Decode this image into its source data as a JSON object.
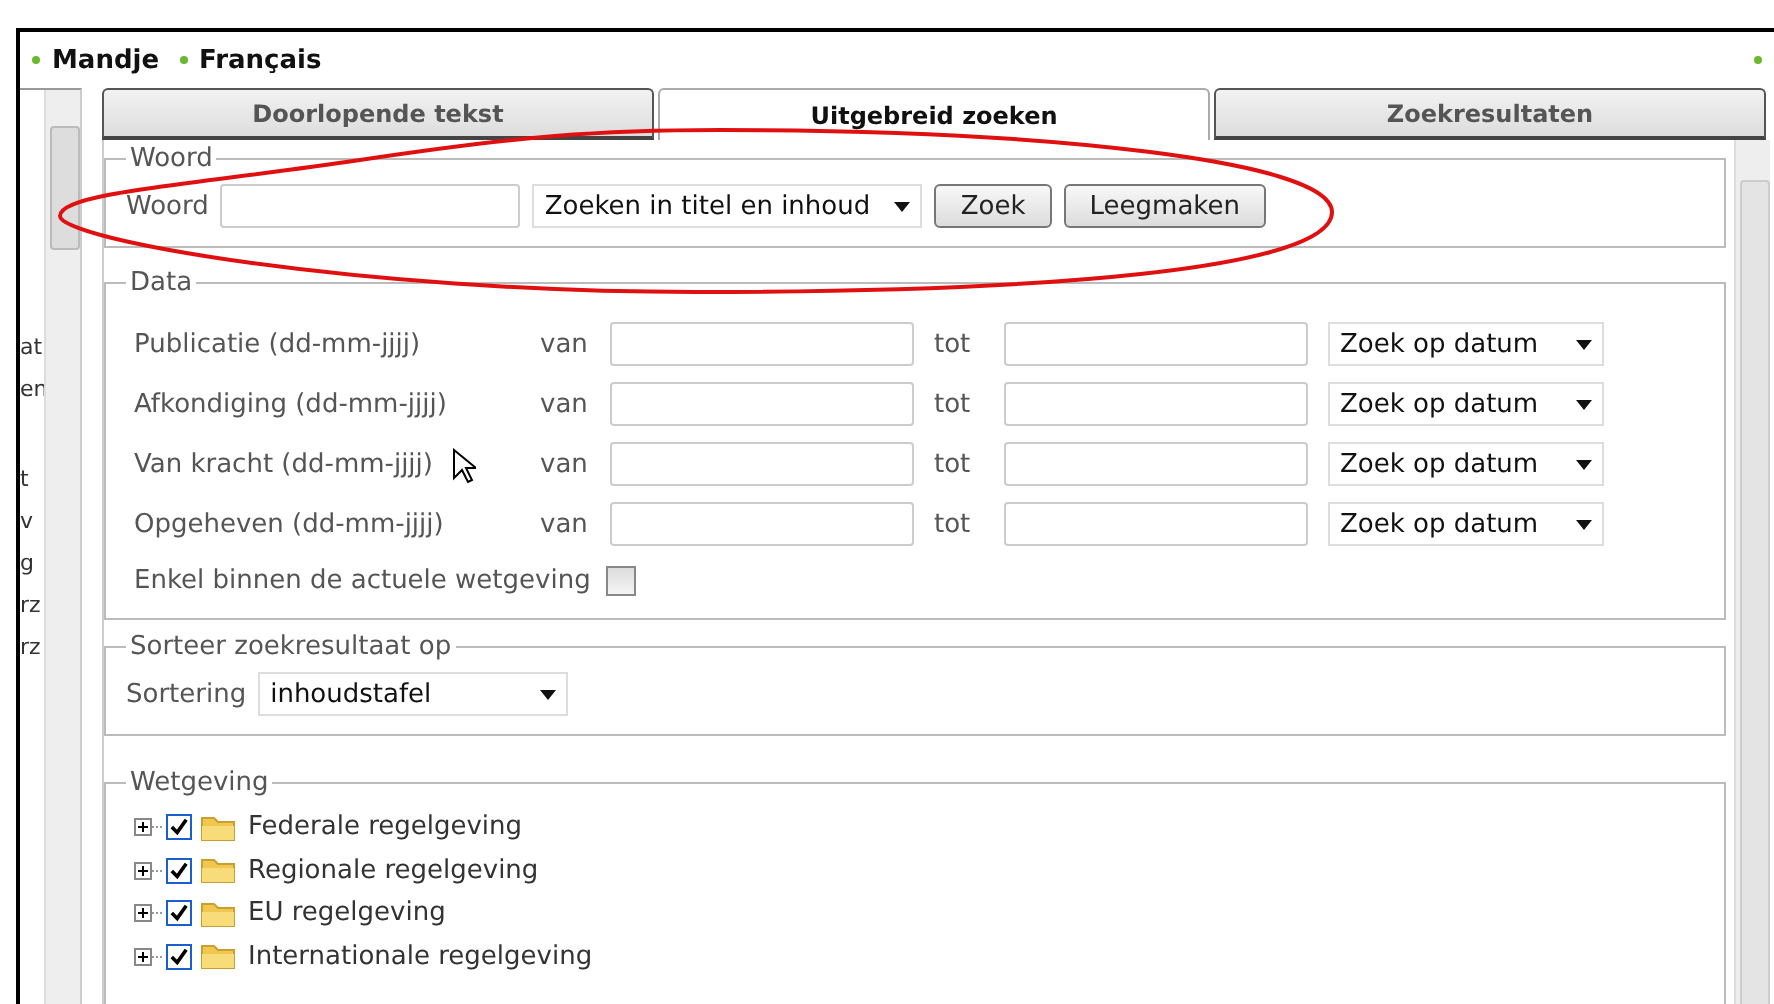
{
  "top_links": [
    {
      "label": "Mandje"
    },
    {
      "label": "Français"
    }
  ],
  "sidebar_fragments": [
    "at",
    "en",
    "t",
    "v",
    "g",
    "rz",
    "rz"
  ],
  "tabs": [
    {
      "label": "Doorlopende tekst",
      "selected": false
    },
    {
      "label": "Uitgebreid zoeken",
      "selected": true
    },
    {
      "label": "Zoekresultaten",
      "selected": false
    }
  ],
  "woord": {
    "legend": "Woord",
    "label": "Woord",
    "scope": "Zoeken in titel en inhoud",
    "buttons": [
      "Zoek",
      "Leegmaken"
    ]
  },
  "data": {
    "legend": "Data",
    "rows": [
      {
        "label": "Publicatie (dd-mm-jjjj)",
        "from_label": "van",
        "to_label": "tot",
        "mode": "Zoek op datum"
      },
      {
        "label": "Afkondiging (dd-mm-jjjj)",
        "from_label": "van",
        "to_label": "tot",
        "mode": "Zoek op datum"
      },
      {
        "label": "Van kracht (dd-mm-jjjj)",
        "from_label": "van",
        "to_label": "tot",
        "mode": "Zoek op datum"
      },
      {
        "label": "Opgeheven (dd-mm-jjjj)",
        "from_label": "van",
        "to_label": "tot",
        "mode": "Zoek op datum"
      }
    ],
    "current_only": {
      "label": "Enkel binnen de actuele wetgeving",
      "checked": false
    }
  },
  "sort": {
    "legend": "Sorteer zoekresultaat op",
    "label": "Sortering",
    "value": "inhoudstafel"
  },
  "legislation": {
    "legend": "Wetgeving",
    "items": [
      {
        "label": "Federale regelgeving",
        "checked": true,
        "expanded": false
      },
      {
        "label": "Regionale regelgeving",
        "checked": true,
        "expanded": false
      },
      {
        "label": "EU regelgeving",
        "checked": true,
        "expanded": false
      },
      {
        "label": "Internationale regelgeving",
        "checked": true,
        "expanded": false
      }
    ]
  }
}
